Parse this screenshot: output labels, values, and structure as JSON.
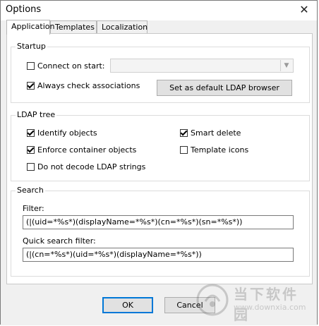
{
  "window": {
    "title": "Options",
    "close_glyph": "✕"
  },
  "tabs": [
    {
      "label": "Application",
      "active": true
    },
    {
      "label": "Templates",
      "active": false
    },
    {
      "label": "Localization",
      "active": false
    }
  ],
  "startup": {
    "title": "Startup",
    "connect_on_start": {
      "label": "Connect on start:",
      "checked": false
    },
    "connect_combo_value": "",
    "always_check": {
      "label": "Always check associations",
      "checked": true
    },
    "set_default_button": "Set as default LDAP browser"
  },
  "ldap_tree": {
    "title": "LDAP tree",
    "identify_objects": {
      "label": "Identify objects",
      "checked": true
    },
    "smart_delete": {
      "label": "Smart delete",
      "checked": true
    },
    "enforce_container": {
      "label": "Enforce container objects",
      "checked": true
    },
    "template_icons": {
      "label": "Template icons",
      "checked": false
    },
    "do_not_decode": {
      "label": "Do not decode LDAP strings",
      "checked": false
    }
  },
  "search": {
    "title": "Search",
    "filter_label": "Filter:",
    "filter_value": "(|(uid=*%s*)(displayName=*%s*)(cn=*%s*)(sn=*%s*))",
    "quick_label": "Quick search filter:",
    "quick_value": "(|(cn=*%s*)(uid=*%s*)(displayName=*%s*))"
  },
  "buttons": {
    "ok": "OK",
    "cancel": "Cancel"
  },
  "watermark": {
    "text": "当下软件园",
    "url": "www.downxia.com"
  },
  "icons": {
    "close": "close-icon",
    "dropdown": "chevron-down-icon",
    "checkbox": "checkbox-icon"
  }
}
